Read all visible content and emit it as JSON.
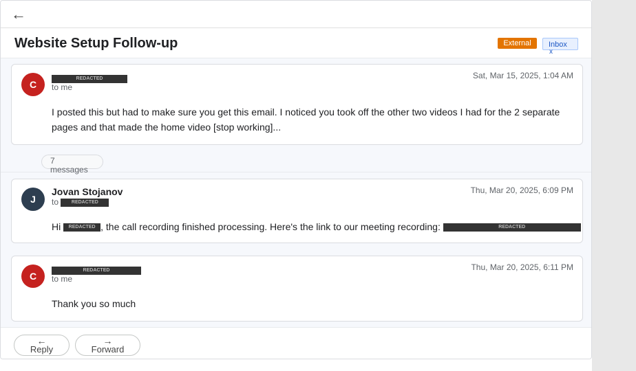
{
  "topbar": {
    "back_glyph": "←"
  },
  "thread": {
    "subject": "Website Setup Follow-up",
    "labels": {
      "external": "External",
      "inbox": "Inbox",
      "inbox_remove": "x"
    }
  },
  "messages": [
    {
      "avatar_letter": "C",
      "avatar_color": "#c5221f",
      "sender_redacted": "REDACTED",
      "to": "to me",
      "date": "Sat, Mar 15, 2025, 1:04 AM",
      "body": "I posted this but had to make sure you get this email. I noticed you took off the other two videos I had for the 2 separate pages and that made the home video [stop working]..."
    },
    {
      "avatar_letter": "J",
      "avatar_color": "#2d3e50",
      "sender": "Jovan Stojanov",
      "to_prefix": "to",
      "to_redacted": "REDACTED",
      "date": "Thu, Mar 20, 2025, 6:09 PM",
      "body_prefix": "Hi",
      "body_redacted_name": "REDACTED",
      "body_middle": ", the call recording finished processing. Here's the link to our meeting recording:",
      "body_redacted_link": "REDACTED"
    },
    {
      "avatar_letter": "C",
      "avatar_color": "#c5221f",
      "sender_redacted": "REDACTED",
      "to": "to me",
      "date": "Thu, Mar 20, 2025, 6:11 PM",
      "body": "Thank you so much"
    }
  ],
  "collapsed": {
    "count": "7",
    "label": "messages"
  },
  "footer": {
    "reply_arrow": "←",
    "reply_label": "Reply",
    "forward_arrow": "→",
    "forward_label": "Forward"
  }
}
